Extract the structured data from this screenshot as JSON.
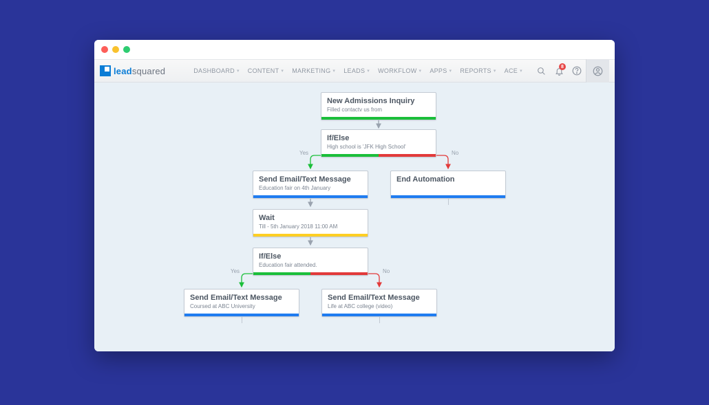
{
  "brand": {
    "part1": "lead",
    "part2": "squared"
  },
  "nav": {
    "items": [
      {
        "label": "DASHBOARD"
      },
      {
        "label": "CONTENT"
      },
      {
        "label": "MARKETING"
      },
      {
        "label": "LEADS"
      },
      {
        "label": "WORKFLOW"
      },
      {
        "label": "APPS"
      },
      {
        "label": "REPORTS"
      },
      {
        "label": "ACE"
      }
    ]
  },
  "notifications": {
    "count": "8"
  },
  "colors": {
    "green": "#1bbf3a",
    "red": "#e23a3a",
    "blue": "#1f7cf0",
    "yellow": "#ffcf24"
  },
  "branchYes": "Yes",
  "branchNo": "No",
  "nodes": {
    "start": {
      "title": "New Admissions Inquiry",
      "sub": "Filled contactv us from"
    },
    "if1": {
      "title": "If/Else",
      "sub": "High school is 'JFK High School'"
    },
    "send1": {
      "title": "Send Email/Text Message",
      "sub": "Education fair on 4th January"
    },
    "end": {
      "title": "End Automation",
      "sub": ""
    },
    "wait": {
      "title": "Wait",
      "sub": "Till - 5th January 2018 11:00 AM"
    },
    "if2": {
      "title": "If/Else",
      "sub": "Education fair attended."
    },
    "send2a": {
      "title": "Send Email/Text Message",
      "sub": "Coursed at ABC University"
    },
    "send2b": {
      "title": "Send Email/Text Message",
      "sub": "Life at ABC college (video)"
    }
  },
  "chart_data": {
    "type": "table",
    "title": "Automation Workflow",
    "nodes": [
      {
        "id": "start",
        "type": "trigger",
        "label": "New Admissions Inquiry",
        "detail": "Filled contactv us from"
      },
      {
        "id": "if1",
        "type": "condition",
        "label": "If/Else",
        "detail": "High school is 'JFK High School'"
      },
      {
        "id": "send1",
        "type": "action",
        "label": "Send Email/Text Message",
        "detail": "Education fair on 4th January"
      },
      {
        "id": "end",
        "type": "end",
        "label": "End Automation",
        "detail": ""
      },
      {
        "id": "wait",
        "type": "wait",
        "label": "Wait",
        "detail": "Till - 5th January 2018 11:00 AM"
      },
      {
        "id": "if2",
        "type": "condition",
        "label": "If/Else",
        "detail": "Education fair attended."
      },
      {
        "id": "send2a",
        "type": "action",
        "label": "Send Email/Text Message",
        "detail": "Coursed at ABC University"
      },
      {
        "id": "send2b",
        "type": "action",
        "label": "Send Email/Text Message",
        "detail": "Life at ABC college (video)"
      }
    ],
    "edges": [
      {
        "from": "start",
        "to": "if1",
        "label": ""
      },
      {
        "from": "if1",
        "to": "send1",
        "label": "Yes"
      },
      {
        "from": "if1",
        "to": "end",
        "label": "No"
      },
      {
        "from": "send1",
        "to": "wait",
        "label": ""
      },
      {
        "from": "wait",
        "to": "if2",
        "label": ""
      },
      {
        "from": "if2",
        "to": "send2a",
        "label": "Yes"
      },
      {
        "from": "if2",
        "to": "send2b",
        "label": "No"
      }
    ]
  }
}
